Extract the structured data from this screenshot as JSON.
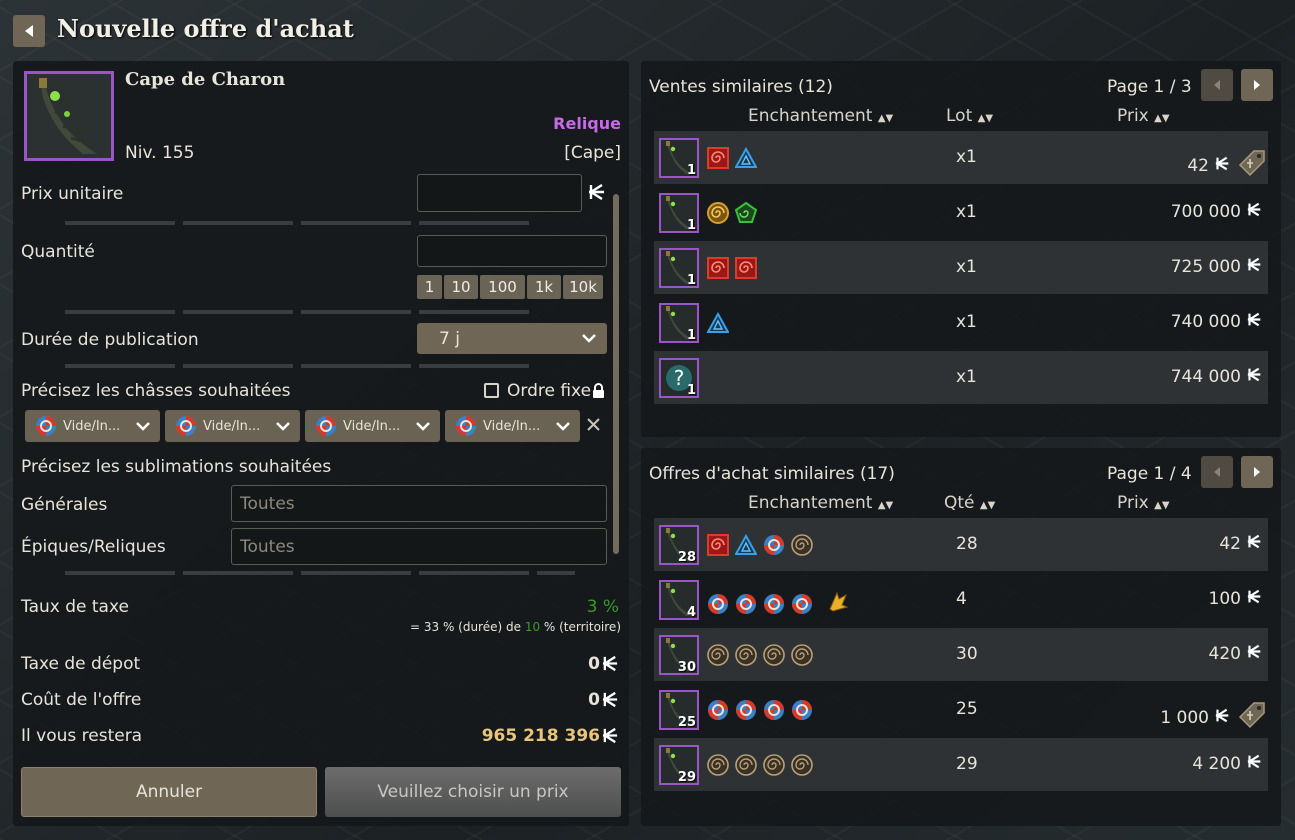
{
  "header": {
    "title": "Nouvelle offre d'achat"
  },
  "item": {
    "name": "Cape de Charon",
    "rarity": "Relique",
    "level": "Niv. 155",
    "type": "[Cape]"
  },
  "form": {
    "unit_price_label": "Prix unitaire",
    "quantity_label": "Quantité",
    "quantity_buttons": [
      "1",
      "10",
      "100",
      "1k",
      "10k"
    ],
    "duration_label": "Durée de publication",
    "duration_value": "7 j",
    "sockets_label": "Précisez les châsses souhaitées",
    "fixed_order_label": "Ordre fixe",
    "sockets": [
      "Vide/In...",
      "Vide/In...",
      "Vide/In...",
      "Vide/In..."
    ],
    "sublimations_label": "Précisez les sublimations souhaitées",
    "general_label": "Générales",
    "general_value": "Toutes",
    "epic_label": "Épiques/Reliques",
    "epic_value": "Toutes"
  },
  "tax": {
    "rate_label": "Taux de taxe",
    "rate_value": "3 %",
    "detail_prefix": "= 33 % (durée) de ",
    "detail_territory": "10",
    "detail_suffix": " % (territoire)",
    "deposit_label": "Taxe de dépot",
    "deposit_value": "0",
    "cost_label": "Coût de l'offre",
    "cost_value": "0",
    "remain_label": "Il vous restera",
    "remain_value": "965 218 396"
  },
  "buttons": {
    "cancel": "Annuler",
    "confirm": "Veuillez choisir un prix"
  },
  "sales": {
    "title": "Ventes similaires (12)",
    "page": "Page 1 / 3",
    "col_enchant": "Enchantement",
    "col_lot": "Lot",
    "col_price": "Prix",
    "rows": [
      {
        "qty": "1",
        "runes": [
          "red-spiral",
          "blue-triangle"
        ],
        "lot": "x1",
        "price": "42",
        "tag": true,
        "unknown": false
      },
      {
        "qty": "1",
        "runes": [
          "gold-spiral",
          "green-pentagon"
        ],
        "lot": "x1",
        "price": "700 000",
        "tag": false,
        "unknown": false
      },
      {
        "qty": "1",
        "runes": [
          "red-spiral",
          "red-spiral"
        ],
        "lot": "x1",
        "price": "725 000",
        "tag": false,
        "unknown": false
      },
      {
        "qty": "1",
        "runes": [
          "blue-triangle"
        ],
        "lot": "x1",
        "price": "740 000",
        "tag": false,
        "unknown": false
      },
      {
        "qty": "1",
        "runes": [],
        "lot": "x1",
        "price": "744 000",
        "tag": false,
        "unknown": true
      }
    ]
  },
  "offers": {
    "title": "Offres d'achat similaires (17)",
    "page": "Page 1 / 4",
    "col_enchant": "Enchantement",
    "col_qty": "Qté",
    "col_price": "Prix",
    "rows": [
      {
        "qty": "28",
        "runes": [
          "red-spiral",
          "blue-triangle",
          "multi-orb",
          "empty-spiral"
        ],
        "count": "28",
        "price": "42",
        "tag": false,
        "sub": false
      },
      {
        "qty": "4",
        "runes": [
          "multi-orb",
          "multi-orb",
          "multi-orb",
          "multi-orb"
        ],
        "count": "4",
        "price": "100",
        "tag": false,
        "sub": true
      },
      {
        "qty": "30",
        "runes": [
          "empty-spiral",
          "empty-spiral",
          "empty-spiral",
          "empty-spiral"
        ],
        "count": "30",
        "price": "420",
        "tag": false,
        "sub": false
      },
      {
        "qty": "25",
        "runes": [
          "multi-orb",
          "multi-orb",
          "multi-orb",
          "multi-orb"
        ],
        "count": "25",
        "price": "1 000",
        "tag": true,
        "sub": false
      },
      {
        "qty": "29",
        "runes": [
          "empty-spiral",
          "empty-spiral",
          "empty-spiral",
          "empty-spiral"
        ],
        "count": "29",
        "price": "4 200",
        "tag": false,
        "sub": false
      }
    ]
  },
  "colors": {
    "rarity": "#c76ae8",
    "tax_green": "#3a9a2a",
    "gold": "#e8c57a",
    "accent_button": "#6f6655"
  }
}
